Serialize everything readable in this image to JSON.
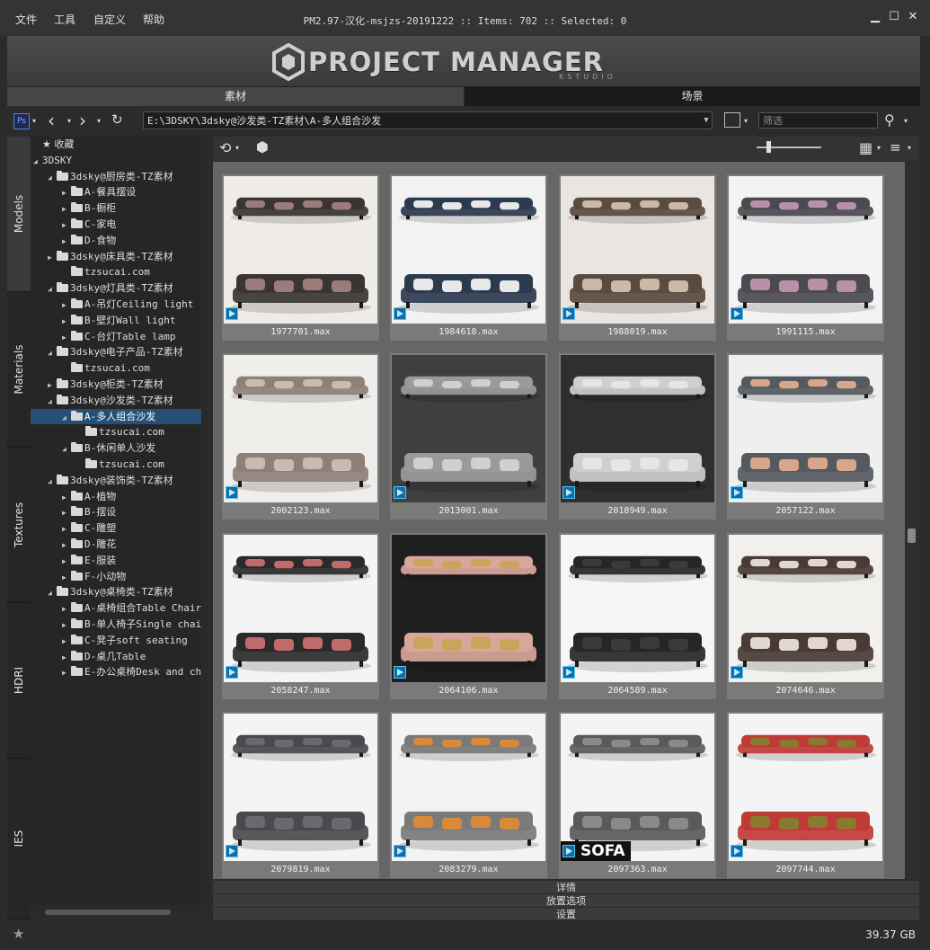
{
  "menu": [
    "文件",
    "工具",
    "自定义",
    "帮助"
  ],
  "window_title": "PM2.97-汉化-msjzs-20191222  :: Items: 702  :: Selected: 0",
  "logo": {
    "text": "PROJECT MANAGER",
    "sub": "KSTUDIO"
  },
  "tabs": [
    "素材",
    "场景"
  ],
  "path": "E:\\3DSKY\\3dsky@沙发类-TZ素材\\A-多人组合沙发",
  "filter_placeholder": "筛选",
  "side_tabs": [
    "Models",
    "Materials",
    "Textures",
    "HDRI",
    "IES"
  ],
  "tree": [
    {
      "label": "收藏",
      "depth": 0,
      "arrow": "",
      "icon": "star"
    },
    {
      "label": "3DSKY",
      "depth": 0,
      "arrow": "◢",
      "icon": "none"
    },
    {
      "label": "3dsky@厨房类-TZ素材",
      "depth": 1,
      "arrow": "◢",
      "icon": "folder"
    },
    {
      "label": "A-餐具摆设",
      "depth": 2,
      "arrow": "▶",
      "icon": "folder"
    },
    {
      "label": "B-橱柜",
      "depth": 2,
      "arrow": "▶",
      "icon": "folder"
    },
    {
      "label": "C-家电",
      "depth": 2,
      "arrow": "▶",
      "icon": "folder"
    },
    {
      "label": "D-食物",
      "depth": 2,
      "arrow": "▶",
      "icon": "folder"
    },
    {
      "label": "3dsky@床具类-TZ素材",
      "depth": 1,
      "arrow": "▶",
      "icon": "folder"
    },
    {
      "label": "tzsucai.com",
      "depth": 2,
      "arrow": "",
      "icon": "folder"
    },
    {
      "label": "3dsky@灯具类-TZ素材",
      "depth": 1,
      "arrow": "◢",
      "icon": "folder"
    },
    {
      "label": "A-吊灯Ceiling light",
      "depth": 2,
      "arrow": "▶",
      "icon": "folder"
    },
    {
      "label": "B-壁灯Wall light",
      "depth": 2,
      "arrow": "▶",
      "icon": "folder"
    },
    {
      "label": "C-台灯Table lamp",
      "depth": 2,
      "arrow": "▶",
      "icon": "folder"
    },
    {
      "label": "3dsky@电子产品-TZ素材",
      "depth": 1,
      "arrow": "◢",
      "icon": "folder"
    },
    {
      "label": "tzsucai.com",
      "depth": 2,
      "arrow": "",
      "icon": "folder"
    },
    {
      "label": "3dsky@柜类-TZ素材",
      "depth": 1,
      "arrow": "▶",
      "icon": "folder"
    },
    {
      "label": "3dsky@沙发类-TZ素材",
      "depth": 1,
      "arrow": "◢",
      "icon": "folder"
    },
    {
      "label": "A-多人组合沙发",
      "depth": 2,
      "arrow": "◢",
      "icon": "folder",
      "selected": true
    },
    {
      "label": "tzsucai.com",
      "depth": 3,
      "arrow": "",
      "icon": "folder"
    },
    {
      "label": "B-休闲单人沙发",
      "depth": 2,
      "arrow": "◢",
      "icon": "folder"
    },
    {
      "label": "tzsucai.com",
      "depth": 3,
      "arrow": "",
      "icon": "folder"
    },
    {
      "label": "3dsky@装饰类-TZ素材",
      "depth": 1,
      "arrow": "◢",
      "icon": "folder"
    },
    {
      "label": "A-植物",
      "depth": 2,
      "arrow": "▶",
      "icon": "folder"
    },
    {
      "label": "B-摆设",
      "depth": 2,
      "arrow": "▶",
      "icon": "folder"
    },
    {
      "label": "C-雕塑",
      "depth": 2,
      "arrow": "▶",
      "icon": "folder"
    },
    {
      "label": "D-雕花",
      "depth": 2,
      "arrow": "▶",
      "icon": "folder"
    },
    {
      "label": "E-服装",
      "depth": 2,
      "arrow": "▶",
      "icon": "folder"
    },
    {
      "label": "F-小动物",
      "depth": 2,
      "arrow": "▶",
      "icon": "folder"
    },
    {
      "label": "3dsky@桌椅类-TZ素材",
      "depth": 1,
      "arrow": "◢",
      "icon": "folder"
    },
    {
      "label": "A-桌椅组合Table Chair",
      "depth": 2,
      "arrow": "▶",
      "icon": "folder"
    },
    {
      "label": "B-单人椅子Single chair",
      "depth": 2,
      "arrow": "▶",
      "icon": "folder"
    },
    {
      "label": "C-凳子soft seating",
      "depth": 2,
      "arrow": "▶",
      "icon": "folder"
    },
    {
      "label": "D-桌几Table",
      "depth": 2,
      "arrow": "▶",
      "icon": "folder"
    },
    {
      "label": "E-办公桌椅Desk and chair",
      "depth": 2,
      "arrow": "▶",
      "icon": "folder"
    }
  ],
  "items": [
    {
      "name": "1977701.max",
      "bg": "#efece8",
      "sofa": "#3a3532",
      "cush": "#9a7c7a"
    },
    {
      "name": "1984618.max",
      "bg": "#f2f2f2",
      "sofa": "#2c3a4e",
      "cush": "#e8e8e8"
    },
    {
      "name": "1988019.max",
      "bg": "#e9e6e1",
      "sofa": "#5a4a40",
      "cush": "#c9b9a6"
    },
    {
      "name": "1991115.max",
      "bg": "#f3f3f3",
      "sofa": "#4a4a50",
      "cush": "#b890a8"
    },
    {
      "name": "2002123.max",
      "bg": "#f0eeeb",
      "sofa": "#8d8078",
      "cush": "#c8bcb2"
    },
    {
      "name": "2013001.max",
      "bg": "#3f3f3f",
      "sofa": "#9a9a9a",
      "cush": "#d0d0d0"
    },
    {
      "name": "2018949.max",
      "bg": "#2f2f2f",
      "sofa": "#cfcfcf",
      "cush": "#e6e6e6"
    },
    {
      "name": "2057122.max",
      "bg": "#efefef",
      "sofa": "#555a60",
      "cush": "#d8a68a"
    },
    {
      "name": "2058247.max",
      "bg": "#f4f4f4",
      "sofa": "#2a2a2a",
      "cush": "#c06a6a"
    },
    {
      "name": "2064106.max",
      "bg": "#1f1f1f",
      "sofa": "#d9a69a",
      "cush": "#c7a55a"
    },
    {
      "name": "2064589.max",
      "bg": "#f6f6f6",
      "sofa": "#262626",
      "cush": "#3a3a3a"
    },
    {
      "name": "2074646.max",
      "bg": "#f2f0ec",
      "sofa": "#4a3a34",
      "cush": "#e0d8d0"
    },
    {
      "name": "2079819.max",
      "bg": "#f4f4f4",
      "sofa": "#4a4a4e",
      "cush": "#6a6a6e"
    },
    {
      "name": "2083279.max",
      "bg": "#f3f3f3",
      "sofa": "#7a7a7a",
      "cush": "#d88a3a"
    },
    {
      "name": "2097363.max",
      "bg": "#f4f4f4",
      "sofa": "#5a5a5a",
      "cush": "#8a8a8a",
      "tag": "SOFA"
    },
    {
      "name": "2097744.max",
      "bg": "#f4f4f4",
      "sofa": "#c03a36",
      "cush": "#8a7a30"
    }
  ],
  "bottom_panels": [
    "详情",
    "放置选项",
    "设置"
  ],
  "disk_free": "39.37 GB"
}
